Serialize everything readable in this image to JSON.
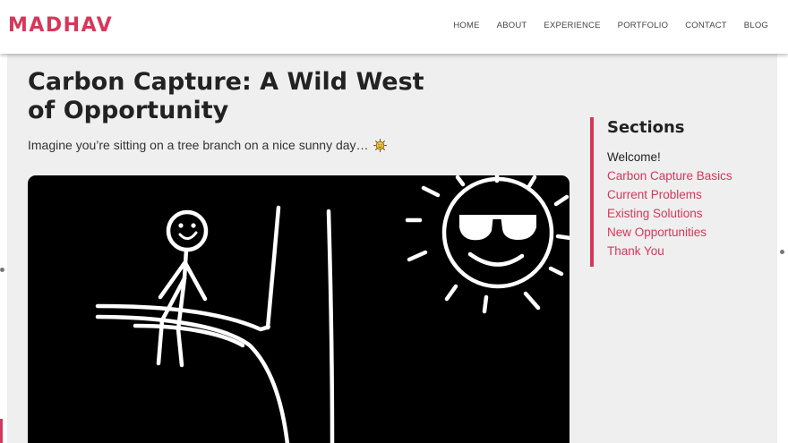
{
  "header": {
    "logo": "MADHAV",
    "nav": [
      "HOME",
      "ABOUT",
      "EXPERIENCE",
      "PORTFOLIO",
      "CONTACT",
      "BLOG"
    ]
  },
  "article": {
    "title": "Carbon Capture: A Wild West of Opportunity",
    "intro": "Imagine you’re sitting on a tree branch on a nice sunny day…",
    "intro_icon": "sun-emoji",
    "illustration_icon": "stick-figure-on-branch-with-sunglasses-sun"
  },
  "sections": {
    "heading": "Sections",
    "items": [
      {
        "label": "Welcome!",
        "active": true
      },
      {
        "label": "Carbon Capture Basics",
        "active": false
      },
      {
        "label": "Current Problems",
        "active": false
      },
      {
        "label": "Existing Solutions",
        "active": false
      },
      {
        "label": "New Opportunities",
        "active": false
      },
      {
        "label": "Thank You",
        "active": false
      }
    ]
  },
  "colors": {
    "accent": "#d6375a",
    "page_bg": "#efefef",
    "text": "#222222"
  }
}
